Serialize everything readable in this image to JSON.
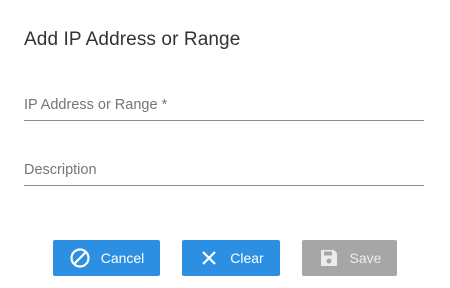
{
  "dialog": {
    "title": "Add IP Address or Range"
  },
  "fields": {
    "ip": {
      "placeholder": "IP Address or Range *",
      "value": ""
    },
    "description": {
      "placeholder": "Description",
      "value": ""
    }
  },
  "buttons": {
    "cancel": {
      "label": "Cancel",
      "icon": "cancel-circle-icon",
      "color": "#2d8fe2"
    },
    "clear": {
      "label": "Clear",
      "icon": "close-icon",
      "color": "#2d8fe2"
    },
    "save": {
      "label": "Save",
      "icon": "floppy-disk-icon",
      "color": "#a6a6a6",
      "disabled": true
    }
  }
}
